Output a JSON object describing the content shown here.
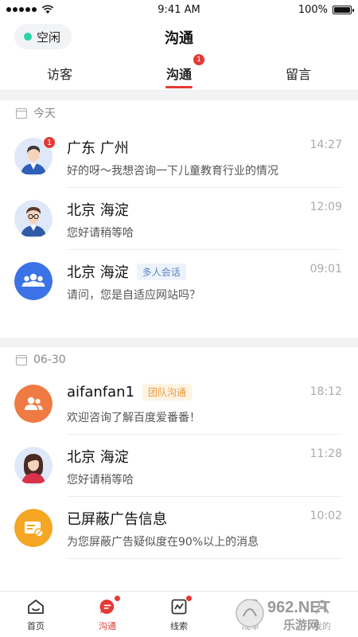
{
  "status_bar": {
    "time": "9:41 AM",
    "battery": "100%",
    "battery_level": 1.0
  },
  "nav": {
    "title": "沟通",
    "status_label": "空闲"
  },
  "tabs": [
    {
      "label": "访客"
    },
    {
      "label": "沟通",
      "badge": "1"
    },
    {
      "label": "留言"
    }
  ],
  "sections": [
    {
      "date": "今天",
      "items": [
        {
          "name": "广东 广州",
          "tag": "",
          "time": "14:27",
          "message": "好的呀～我想咨询一下儿童教育行业的情况",
          "badge": "1",
          "avatar": "male-avatar-icon"
        },
        {
          "name": "北京 海淀",
          "tag": "",
          "time": "12:09",
          "message": "您好请稍等哈",
          "avatar": "male-glasses-avatar-icon"
        },
        {
          "name": "北京 海淀",
          "tag": "多人会话",
          "time": "09:01",
          "message": "请问，您是自适应网站吗？",
          "avatar": "group-icon"
        }
      ]
    },
    {
      "date": "06-30",
      "items": [
        {
          "name": "aifanfan1",
          "tag": "团队沟通",
          "time": "18:12",
          "message": "欢迎咨询了解百度爱番番！",
          "avatar": "team-icon"
        },
        {
          "name": "北京 海淀",
          "tag": "",
          "time": "11:28",
          "message": "您好请稍等哈",
          "avatar": "female-avatar-icon"
        },
        {
          "name": "已屏蔽广告信息",
          "tag": "",
          "time": "10:02",
          "message": "为您屏蔽广告疑似度在90%以上的消息",
          "avatar": "blocked-ad-icon"
        }
      ]
    }
  ],
  "bottom_nav": [
    {
      "label": "首页",
      "icon": "home-icon"
    },
    {
      "label": "沟通",
      "icon": "chat-icon"
    },
    {
      "label": "线索",
      "icon": "leads-icon"
    },
    {
      "label": "成单",
      "icon": "orders-icon"
    },
    {
      "label": "我的",
      "icon": "profile-icon"
    }
  ],
  "watermark": "962.NET 乐游网",
  "colors": {
    "accent": "#e53935",
    "online": "#2bd3a8",
    "group_blue": "#3b73e6",
    "team_orange": "#f07a43",
    "ad_amber": "#f5a623"
  }
}
